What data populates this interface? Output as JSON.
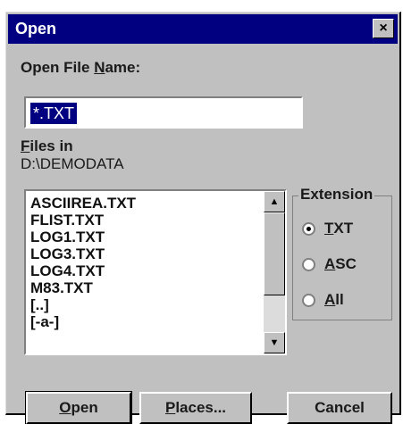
{
  "window": {
    "title": "Open",
    "close_glyph": "×"
  },
  "filename": {
    "label_pre": "Open File ",
    "label_mnemonic": "N",
    "label_post": "ame:",
    "value": "*.TXT"
  },
  "location": {
    "label_mnemonic": "F",
    "label_post": "iles in",
    "path": "D:\\DEMODATA"
  },
  "files": [
    "ASCIIREA.TXT",
    "FLIST.TXT",
    "LOG1.TXT",
    "LOG3.TXT",
    "LOG4.TXT",
    "M83.TXT",
    "[..]",
    "[-a-]"
  ],
  "extension": {
    "title": "Extension",
    "options": [
      {
        "mnemonic": "T",
        "rest": "XT",
        "selected": true
      },
      {
        "mnemonic": "A",
        "rest": "SC",
        "selected": false
      },
      {
        "mnemonic": "A",
        "rest": "ll",
        "selected": false
      }
    ]
  },
  "buttons": {
    "open": {
      "mnemonic": "O",
      "rest": "pen"
    },
    "places": {
      "mnemonic": "P",
      "rest": "laces..."
    },
    "cancel": {
      "label": "Cancel"
    }
  },
  "colors": {
    "titlebar": "#000080",
    "face": "#c0c0c0",
    "selection": "#000080"
  },
  "icons": {
    "close": "close-icon",
    "scroll_up": "scroll-up-icon",
    "scroll_down": "scroll-down-icon"
  }
}
